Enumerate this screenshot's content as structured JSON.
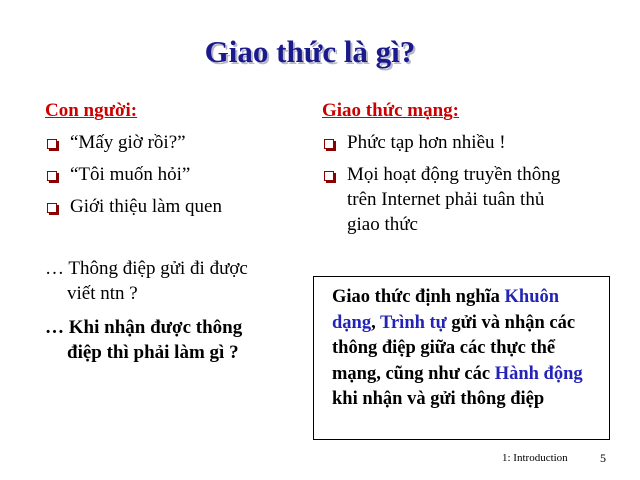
{
  "title": "Giao thức là gì?",
  "left": {
    "heading": "Con người:",
    "bullets": [
      "“Mấy giờ rồi?”",
      "“Tôi muốn hỏi”",
      "Giới thiệu làm quen"
    ],
    "notes": [
      "… Thông điệp gửi đi được viết ntn ?",
      "… Khi nhận được thông điệp thì phải làm gì ?"
    ]
  },
  "right": {
    "heading": "Giao thức mạng:",
    "bullets": [
      "Phức tạp hơn nhiều !",
      "Mọi hoạt động truyền thông trên Internet phải tuân thủ giao thức"
    ]
  },
  "definition": {
    "t1": "Giao thức định nghĩa ",
    "k1": "Khuôn dạng",
    "t2": ", ",
    "k2": "Trình tự",
    "t3": " gửi và nhận các thông điệp giữa các thực thể mạng, cũng như các ",
    "k3": "Hành động",
    "t4": " khi nhận và gửi thông điệp"
  },
  "footer": {
    "label": "1: Introduction",
    "page": "5"
  },
  "colors": {
    "title": "#1a1a8c",
    "heading": "#cc0000",
    "keyword": "#2323b8",
    "bullet": "#8b0000"
  }
}
